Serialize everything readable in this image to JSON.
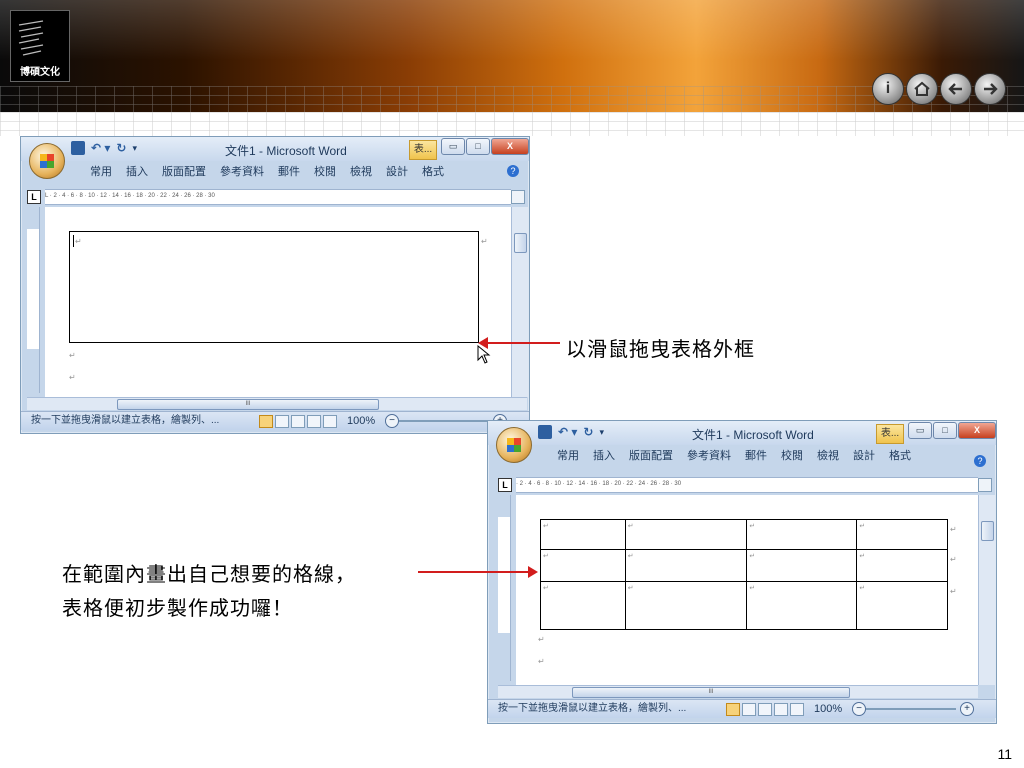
{
  "logo": {
    "text": "博碩文化"
  },
  "nav": {
    "info_icon": "info-icon",
    "home_icon": "home-icon",
    "back_icon": "back-arrow-icon",
    "forward_icon": "forward-arrow-icon"
  },
  "window1": {
    "title": "文件1 - Microsoft Word",
    "context_tab": "表...",
    "tabs": [
      "常用",
      "插入",
      "版面配置",
      "參考資料",
      "郵件",
      "校閱",
      "檢視",
      "設計",
      "格式"
    ],
    "ruler": "L   ·  2  ·  4  ·  6  ·  8  · 10 · 12 · 14 · 16 · 18 · 20 · 22 · 24 · 26 · 28 · 30",
    "hscroll_thumb": "III",
    "status_text": "按一下並拖曳滑鼠以建立表格，繪製列、...",
    "zoom": "100%"
  },
  "window2": {
    "title": "文件1 - Microsoft Word",
    "context_tab": "表...",
    "tabs": [
      "常用",
      "插入",
      "版面配置",
      "參考資料",
      "郵件",
      "校閱",
      "檢視",
      "設計",
      "格式"
    ],
    "ruler": "·  2  ·  4  ·  6  ·  8  · 10 · 12 · 14 · 16 · 18 · 20 · 22 · 24 · 26 · 28 · 30",
    "hscroll_thumb": "III",
    "status_text": "按一下並拖曳滑鼠以建立表格，繪製列、...",
    "zoom": "100%"
  },
  "annotations": {
    "drag_border": "以滑鼠拖曳表格外框",
    "draw_lines_line1": "在範圍內畫出自己想要的格線，",
    "draw_lines_line2": "表格便初步製作成功囉！"
  },
  "page_number": "11",
  "colors": {
    "accent_arrow": "#d21d1d",
    "header_orange": "#d0700e"
  }
}
